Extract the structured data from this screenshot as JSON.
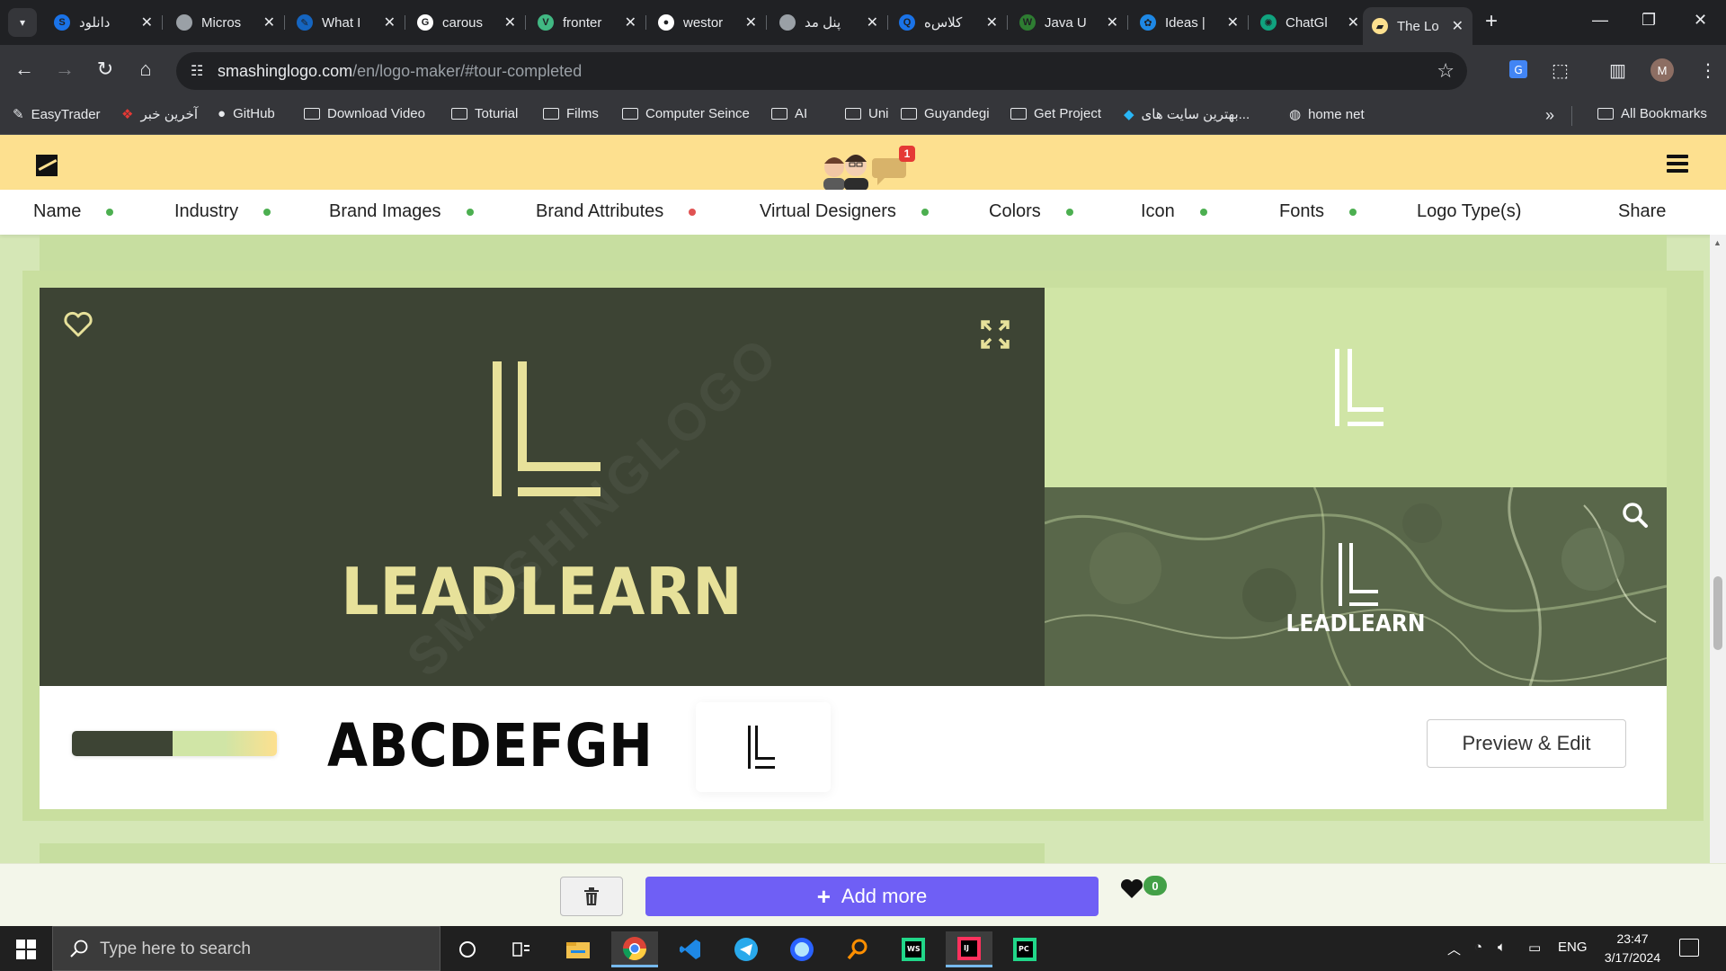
{
  "browser": {
    "tabs": [
      {
        "title": "دانلود",
        "fav_color": "#1a73e8",
        "fav_glyph": "S"
      },
      {
        "title": "Micros",
        "fav_color": "#9aa0a6",
        "fav_glyph": ""
      },
      {
        "title": "What I",
        "fav_color": "#1565c0",
        "fav_glyph": "✎"
      },
      {
        "title": "carous",
        "fav_color": "#ffffff",
        "fav_glyph": "G"
      },
      {
        "title": "fronter",
        "fav_color": "#41b883",
        "fav_glyph": "V"
      },
      {
        "title": "westor",
        "fav_color": "#ffffff",
        "fav_glyph": "●"
      },
      {
        "title": "پنل مد",
        "fav_color": "#9aa0a6",
        "fav_glyph": ""
      },
      {
        "title": "کلاس‌ه",
        "fav_color": "#1a73e8",
        "fav_glyph": "Q"
      },
      {
        "title": "Java U",
        "fav_color": "#2e7d32",
        "fav_glyph": "W"
      },
      {
        "title": "Ideas |",
        "fav_color": "#1e88e5",
        "fav_glyph": "✿"
      },
      {
        "title": "ChatGl",
        "fav_color": "#10a37f",
        "fav_glyph": "✺"
      },
      {
        "title": "The Lo",
        "fav_color": "#fde08f",
        "fav_glyph": "▰"
      }
    ],
    "url_host": "smashinglogo.com",
    "url_path": "/en/logo-maker/#tour-completed",
    "profile_initial": "M",
    "bookmarks": [
      {
        "label": "EasyTrader",
        "type": "link"
      },
      {
        "label": "آخرین خبر",
        "type": "link"
      },
      {
        "label": "GitHub",
        "type": "link"
      },
      {
        "label": "Download Video",
        "type": "folder"
      },
      {
        "label": "Toturial",
        "type": "folder"
      },
      {
        "label": "Films",
        "type": "folder"
      },
      {
        "label": "Computer Seince",
        "type": "folder"
      },
      {
        "label": "AI",
        "type": "folder"
      },
      {
        "label": "Uni",
        "type": "folder"
      },
      {
        "label": "Guyandegi",
        "type": "folder"
      },
      {
        "label": "Get Project",
        "type": "folder"
      },
      {
        "label": "بهترین سایت های...",
        "type": "link"
      },
      {
        "label": "home net",
        "type": "link"
      }
    ],
    "all_bookmarks_label": "All Bookmarks"
  },
  "site": {
    "notification_count": "1",
    "steps": [
      {
        "label": "Name",
        "status": "done"
      },
      {
        "label": "Industry",
        "status": "done"
      },
      {
        "label": "Brand Images",
        "status": "done"
      },
      {
        "label": "Brand Attributes",
        "status": "incomplete"
      },
      {
        "label": "Virtual Designers",
        "status": "done"
      },
      {
        "label": "Colors",
        "status": "done"
      },
      {
        "label": "Icon",
        "status": "done"
      },
      {
        "label": "Fonts",
        "status": "done"
      },
      {
        "label": "Logo Type(s)",
        "status": "none"
      },
      {
        "label": "Share",
        "status": "none"
      }
    ],
    "logo_card": {
      "brand_name": "LEADLEARN",
      "watermark": "SMASHINGLOGO",
      "palette": [
        "#3d4434",
        "#d0e5a6",
        "#fde08f"
      ],
      "font_sample": "ABCDEFGH",
      "preview_edit_label": "Preview & Edit",
      "colors": {
        "dark_bg": "#3d4434",
        "light_bg": "#d0e5a6",
        "accent_text": "#e7e19a"
      }
    },
    "bottom_bar": {
      "add_more_label": "Add more",
      "favorites_count": "0"
    }
  },
  "taskbar": {
    "search_placeholder": "Type here to search",
    "language": "ENG",
    "time": "23:47",
    "date": "3/17/2024"
  }
}
